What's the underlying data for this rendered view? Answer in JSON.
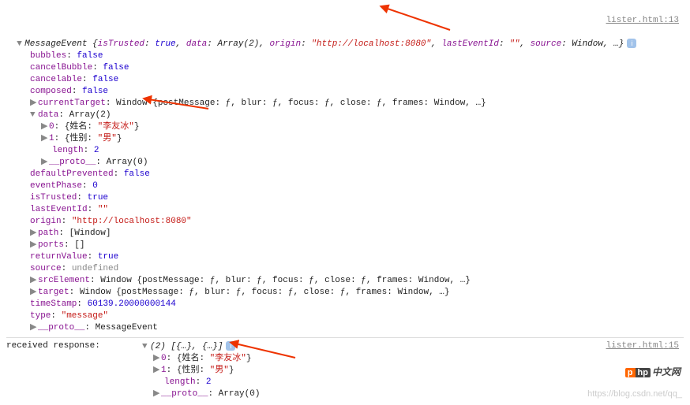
{
  "source1": {
    "file": "lister.html",
    "line": 13
  },
  "source2": {
    "file": "lister.html",
    "line": 15
  },
  "header": {
    "class": "MessageEvent",
    "isTrustedKey": "isTrusted",
    "isTrustedVal": "true",
    "dataKey": "data",
    "dataVal": "Array(2)",
    "originKey": "origin",
    "originVal": "\"http://localhost:8080\"",
    "lastEventIdKey": "lastEventId",
    "lastEventIdVal": "\"\"",
    "sourceKey": "source",
    "sourceVal": "Window"
  },
  "props": {
    "bubbles": {
      "k": "bubbles",
      "v": "false"
    },
    "cancelBubble": {
      "k": "cancelBubble",
      "v": "false"
    },
    "cancelable": {
      "k": "cancelable",
      "v": "false"
    },
    "composed": {
      "k": "composed",
      "v": "false"
    },
    "currentTarget": {
      "k": "currentTarget",
      "v": "Window {postMessage: ƒ, blur: ƒ, focus: ƒ, close: ƒ, frames: Window, …}"
    },
    "data": {
      "k": "data",
      "v": "Array(2)"
    },
    "d0k": "0",
    "d0obj": "{姓名: ",
    "d0val": "\"李友冰\"",
    "d0end": "}",
    "d1k": "1",
    "d1obj": "{性别: ",
    "d1val": "\"男\"",
    "d1end": "}",
    "lengthK": "length",
    "lengthV": "2",
    "protoK": "__proto__",
    "protoV": "Array(0)",
    "defaultPrevented": {
      "k": "defaultPrevented",
      "v": "false"
    },
    "eventPhase": {
      "k": "eventPhase",
      "v": "0"
    },
    "isTrusted": {
      "k": "isTrusted",
      "v": "true"
    },
    "lastEventId": {
      "k": "lastEventId",
      "v": "\"\""
    },
    "origin": {
      "k": "origin",
      "v": "\"http://localhost:8080\""
    },
    "path": {
      "k": "path",
      "v": "[Window]"
    },
    "ports": {
      "k": "ports",
      "v": "[]"
    },
    "returnValue": {
      "k": "returnValue",
      "v": "true"
    },
    "source": {
      "k": "source",
      "v": "undefined"
    },
    "srcElement": {
      "k": "srcElement",
      "v": "Window {postMessage: ƒ, blur: ƒ, focus: ƒ, close: ƒ, frames: Window, …}"
    },
    "target": {
      "k": "target",
      "v": "Window {postMessage: ƒ, blur: ƒ, focus: ƒ, close: ƒ, frames: Window, …}"
    },
    "timeStamp": {
      "k": "timeStamp",
      "v": "60139.20000000144"
    },
    "type": {
      "k": "type",
      "v": "\"message\""
    },
    "proto2": {
      "k": "__proto__",
      "v": "MessageEvent"
    }
  },
  "resp": {
    "label": "received response:  ",
    "summary": "(2) [{…}, {…}]",
    "d0k": "0",
    "d0obj": "{姓名: ",
    "d0val": "\"李友冰\"",
    "d0end": "}",
    "d1k": "1",
    "d1obj": "{性别: ",
    "d1val": "\"男\"",
    "d1end": "}",
    "lengthK": "length",
    "lengthV": "2",
    "protoK": "__proto__",
    "protoV": "Array(0)"
  },
  "watermark": "https://blog.csdn.net/qq_",
  "logo": {
    "p": "p",
    "hp": "hp",
    "cn": "中文网"
  },
  "chart_data": {
    "type": "table",
    "title": "MessageEvent properties (DevTools console)",
    "rows": [
      [
        "bubbles",
        false
      ],
      [
        "cancelBubble",
        false
      ],
      [
        "cancelable",
        false
      ],
      [
        "composed",
        false
      ],
      [
        "currentTarget",
        "Window {postMessage: ƒ, blur: ƒ, focus: ƒ, close: ƒ, frames: Window, …}"
      ],
      [
        "data",
        [
          {
            "姓名": "李友冰"
          },
          {
            "性别": "男"
          }
        ]
      ],
      [
        "defaultPrevented",
        false
      ],
      [
        "eventPhase",
        0
      ],
      [
        "isTrusted",
        true
      ],
      [
        "lastEventId",
        ""
      ],
      [
        "origin",
        "http://localhost:8080"
      ],
      [
        "path",
        "[Window]"
      ],
      [
        "ports",
        "[]"
      ],
      [
        "returnValue",
        true
      ],
      [
        "source",
        "undefined"
      ],
      [
        "srcElement",
        "Window {postMessage: ƒ, blur: ƒ, focus: ƒ, close: ƒ, frames: Window, …}"
      ],
      [
        "target",
        "Window {postMessage: ƒ, blur: ƒ, focus: ƒ, close: ƒ, frames: Window, …}"
      ],
      [
        "timeStamp",
        60139.20000000144
      ],
      [
        "type",
        "message"
      ],
      [
        "__proto__",
        "MessageEvent"
      ]
    ]
  }
}
